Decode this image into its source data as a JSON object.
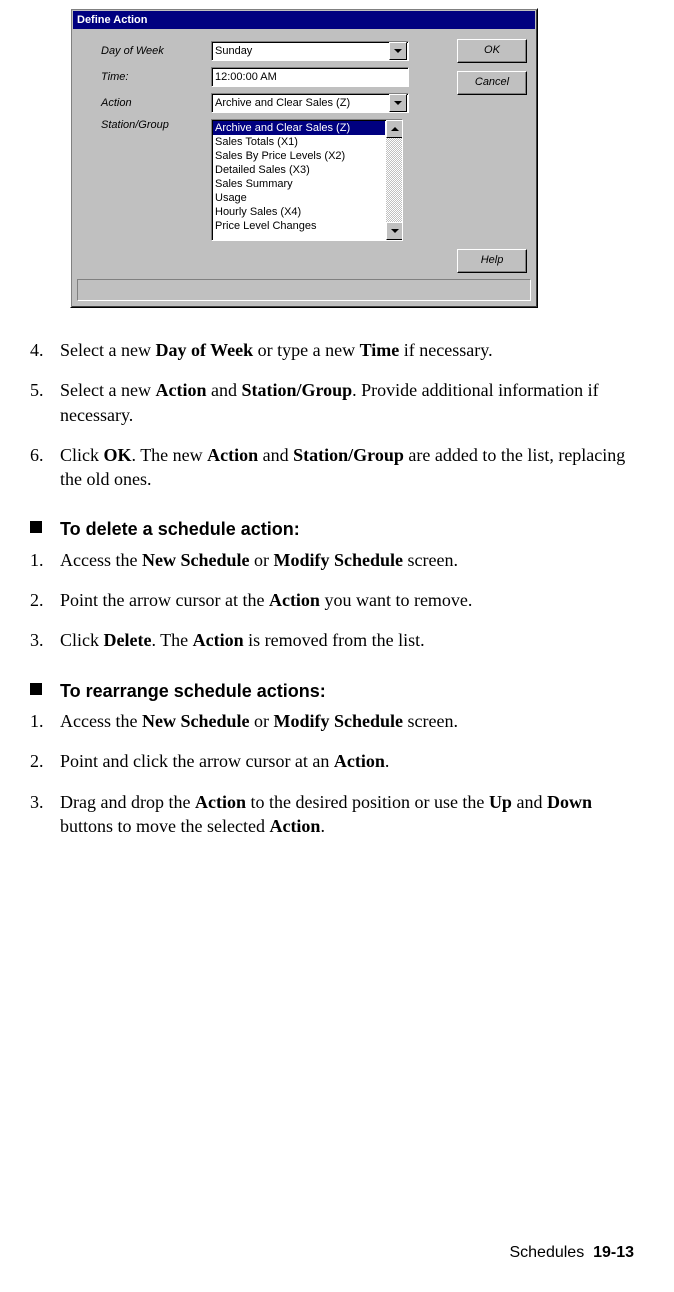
{
  "dialog": {
    "title": "Define Action",
    "labels": {
      "day_of_week": "Day of Week",
      "time": "Time:",
      "action": "Action",
      "station_group": "Station/Group"
    },
    "values": {
      "day_of_week": "Sunday",
      "time": "12:00:00 AM",
      "action": "Archive and Clear Sales (Z)"
    },
    "list_items": [
      "Archive and Clear Sales (Z)",
      "Sales Totals (X1)",
      "Sales By Price Levels (X2)",
      "Detailed Sales (X3)",
      "Sales Summary",
      "Usage",
      "Hourly Sales (X4)",
      "Price Level Changes"
    ],
    "buttons": {
      "ok": "OK",
      "cancel": "Cancel",
      "help": "Help"
    }
  },
  "steps_a": [
    {
      "n": "4.",
      "plain1": "Select a new ",
      "b1": "Day of Week",
      "plain2": " or type a new ",
      "b2": "Time",
      "plain3": " if necessary."
    },
    {
      "n": "5.",
      "plain1": "Select a new ",
      "b1": "Action",
      "plain2": " and ",
      "b2": "Station/Group",
      "plain3": ". Provide additional information if necessary."
    },
    {
      "n": "6.",
      "plain1": "Click ",
      "b1": "OK",
      "plain2": ". The new ",
      "b2": "Action",
      "plain3": " and ",
      "b3": "Station/Group",
      "plain4": " are added to the list, replacing the old ones."
    }
  ],
  "heading_delete": "To delete a schedule action:",
  "steps_b": [
    {
      "n": "1.",
      "plain1": "Access the ",
      "b1": "New Schedule",
      "plain2": " or ",
      "b2": "Modify Schedule",
      "plain3": " screen."
    },
    {
      "n": "2.",
      "plain1": "Point the arrow cursor at the ",
      "b1": "Action",
      "plain2": " you want to remove."
    },
    {
      "n": "3.",
      "plain1": "Click ",
      "b1": "Delete",
      "plain2": ". The ",
      "b2": "Action",
      "plain3": " is removed from the list."
    }
  ],
  "heading_rearrange": "To rearrange schedule actions:",
  "steps_c": [
    {
      "n": "1.",
      "plain1": "Access the ",
      "b1": "New Schedule",
      "plain2": " or ",
      "b2": "Modify Schedule",
      "plain3": " screen."
    },
    {
      "n": "2.",
      "plain1": "Point and click the arrow cursor at an ",
      "b1": "Action",
      "plain2": "."
    },
    {
      "n": "3.",
      "plain1": "Drag and drop the ",
      "b1": "Action",
      "plain2": " to the desired position or use the ",
      "b2": "Up",
      "plain3": " and ",
      "b3": "Down",
      "plain4": " buttons to move the selected ",
      "b4": "Action",
      "plain5": "."
    }
  ],
  "footer": {
    "label": "Schedules",
    "page": "19-13"
  }
}
